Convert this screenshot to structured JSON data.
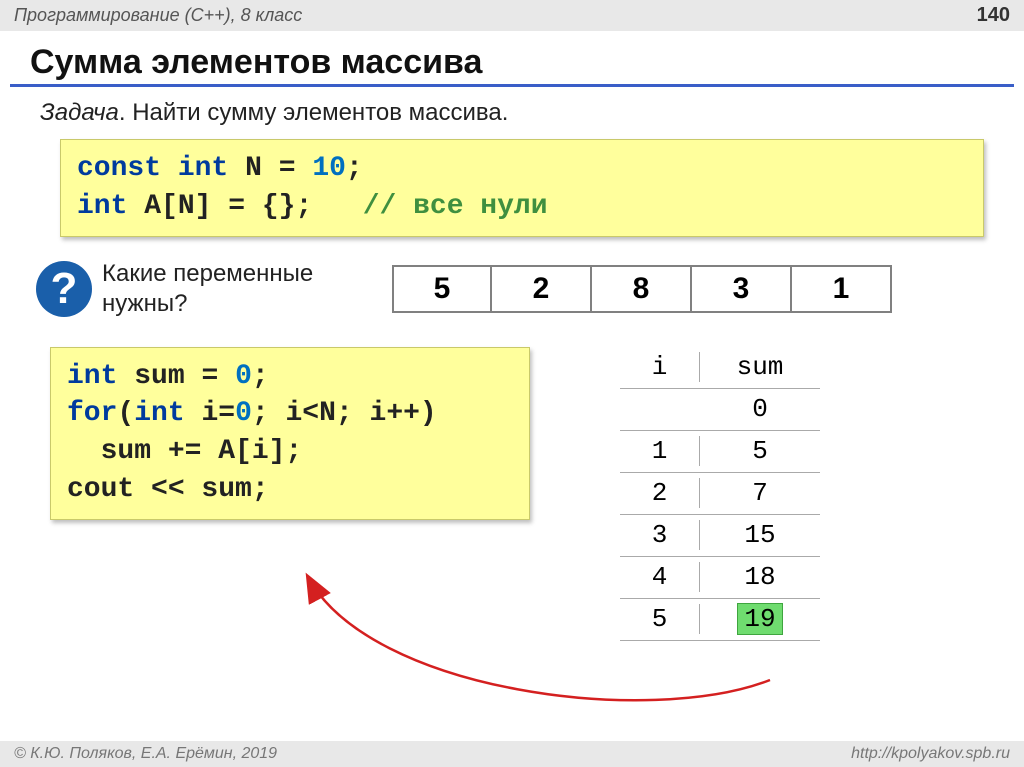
{
  "header": {
    "course": "Программирование (C++), 8 класс",
    "page": "140"
  },
  "title": "Сумма элементов массива",
  "task": {
    "label": "Задача",
    "text": ". Найти сумму элементов массива."
  },
  "code1": {
    "l1_const": "const",
    "l1_int": "int",
    "l1_name": "N",
    "l1_eq": "=",
    "l1_val": "10",
    "l1_semi": ";",
    "l2_int": "int",
    "l2_body": "A[N] = {};",
    "l2_comment": "// все нули"
  },
  "question": {
    "mark": "?",
    "text_l1": "Какие переменные",
    "text_l2": "нужны?"
  },
  "array_values": [
    "5",
    "2",
    "8",
    "3",
    "1"
  ],
  "code2": {
    "l1_int": "int",
    "l1_rest": "sum = ",
    "l1_zero": "0",
    "l1_semi": ";",
    "l2_for": "for",
    "l2_open": "(",
    "l2_int": "int",
    "l2_a": " i=",
    "l2_zero": "0",
    "l2_b": "; i<N; i++)",
    "l3": "  sum += A[i];",
    "l4": "cout << sum;"
  },
  "trace": {
    "head_i": "i",
    "head_sum": "sum",
    "rows": [
      {
        "i": "",
        "sum": "0"
      },
      {
        "i": "1",
        "sum": "5"
      },
      {
        "i": "2",
        "sum": "7"
      },
      {
        "i": "3",
        "sum": "15"
      },
      {
        "i": "4",
        "sum": "18"
      },
      {
        "i": "5",
        "sum": "19",
        "hl": true
      }
    ]
  },
  "footer": {
    "left": "© К.Ю. Поляков, Е.А. Ерёмин, 2019",
    "right": "http://kpolyakov.spb.ru"
  }
}
